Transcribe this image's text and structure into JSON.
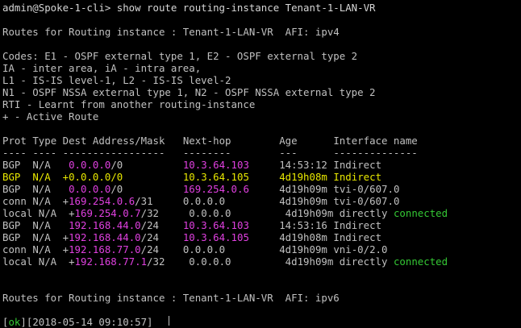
{
  "prompt": "admin@Spoke-1-cli> show route routing-instance Tenant-1-LAN-VR",
  "ipv4_header": "Routes for Routing instance : Tenant-1-LAN-VR  AFI: ipv4",
  "codes": [
    "Codes: E1 - OSPF external type 1, E2 - OSPF external type 2",
    "IA - inter area, iA - intra area,",
    "L1 - IS-IS level-1, L2 - IS-IS level-2",
    "N1 - OSPF NSSA external type 1, N2 - OSPF NSSA external type 2",
    "RTI - Learnt from another routing-instance",
    "+ - Active Route"
  ],
  "table_header": {
    "prot": "Prot",
    "type": "Type",
    "dest": "Dest Address/Mask",
    "nexthop": "Next-hop",
    "age": "Age",
    "iface": "Interface name"
  },
  "table_rule": {
    "prot": "----",
    "type": "----",
    "dest": "-----------------",
    "nexthop": "--------",
    "age": "---",
    "iface": "--------------"
  },
  "routes": [
    {
      "prot": "BGP",
      "type": "N/A",
      "active": " ",
      "addr": "0.0.0.0",
      "mask": "/0",
      "nexthop": "10.3.64.103",
      "age": "14:53:12",
      "iface_a": "Indirect",
      "iface_b": ""
    },
    {
      "prot": "BGP",
      "type": "N/A",
      "active": "+",
      "addr": "0.0.0.0",
      "mask": "/0",
      "nexthop": "10.3.64.105",
      "age": "4d19h08m",
      "iface_a": "Indirect",
      "iface_b": ""
    },
    {
      "prot": "BGP",
      "type": "N/A",
      "active": " ",
      "addr": "0.0.0.0",
      "mask": "/0",
      "nexthop": "169.254.0.6",
      "age": "4d19h09m",
      "iface_a": "tvi-0/607.0",
      "iface_b": ""
    },
    {
      "prot": "conn",
      "type": "N/A",
      "active": "+",
      "addr": "169.254.0.6",
      "mask": "/31",
      "nexthop": "0.0.0.0",
      "age": "4d19h09m",
      "iface_a": "tvi-0/607.0",
      "iface_b": ""
    },
    {
      "prot": "local",
      "type": "N/A",
      "active": "+",
      "addr": "169.254.0.7",
      "mask": "/32",
      "nexthop": "0.0.0.0",
      "age": "4d19h09m",
      "iface_a": "directly ",
      "iface_b": "connected"
    },
    {
      "prot": "BGP",
      "type": "N/A",
      "active": " ",
      "addr": "192.168.44.0",
      "mask": "/24",
      "nexthop": "10.3.64.103",
      "age": "14:53:16",
      "iface_a": "Indirect",
      "iface_b": ""
    },
    {
      "prot": "BGP",
      "type": "N/A",
      "active": "+",
      "addr": "192.168.44.0",
      "mask": "/24",
      "nexthop": "10.3.64.105",
      "age": "4d19h08m",
      "iface_a": "Indirect",
      "iface_b": ""
    },
    {
      "prot": "conn",
      "type": "N/A",
      "active": "+",
      "addr": "192.168.77.0",
      "mask": "/24",
      "nexthop": "0.0.0.0",
      "age": "4d19h09m",
      "iface_a": "vni-0/2.0",
      "iface_b": ""
    },
    {
      "prot": "local",
      "type": "N/A",
      "active": "+",
      "addr": "192.168.77.1",
      "mask": "/32",
      "nexthop": "0.0.0.0",
      "age": "4d19h09m",
      "iface_a": "directly ",
      "iface_b": "connected"
    }
  ],
  "ipv6_header": "Routes for Routing instance : Tenant-1-LAN-VR  AFI: ipv6",
  "status": {
    "ok": "ok",
    "timestamp": "[2018-05-14 09:10:57]"
  },
  "colors": {
    "background": "#000000",
    "text": "#c0c0c0",
    "highlight_row": "#e8e800",
    "address": "#e040e0",
    "connected": "#34c834"
  }
}
